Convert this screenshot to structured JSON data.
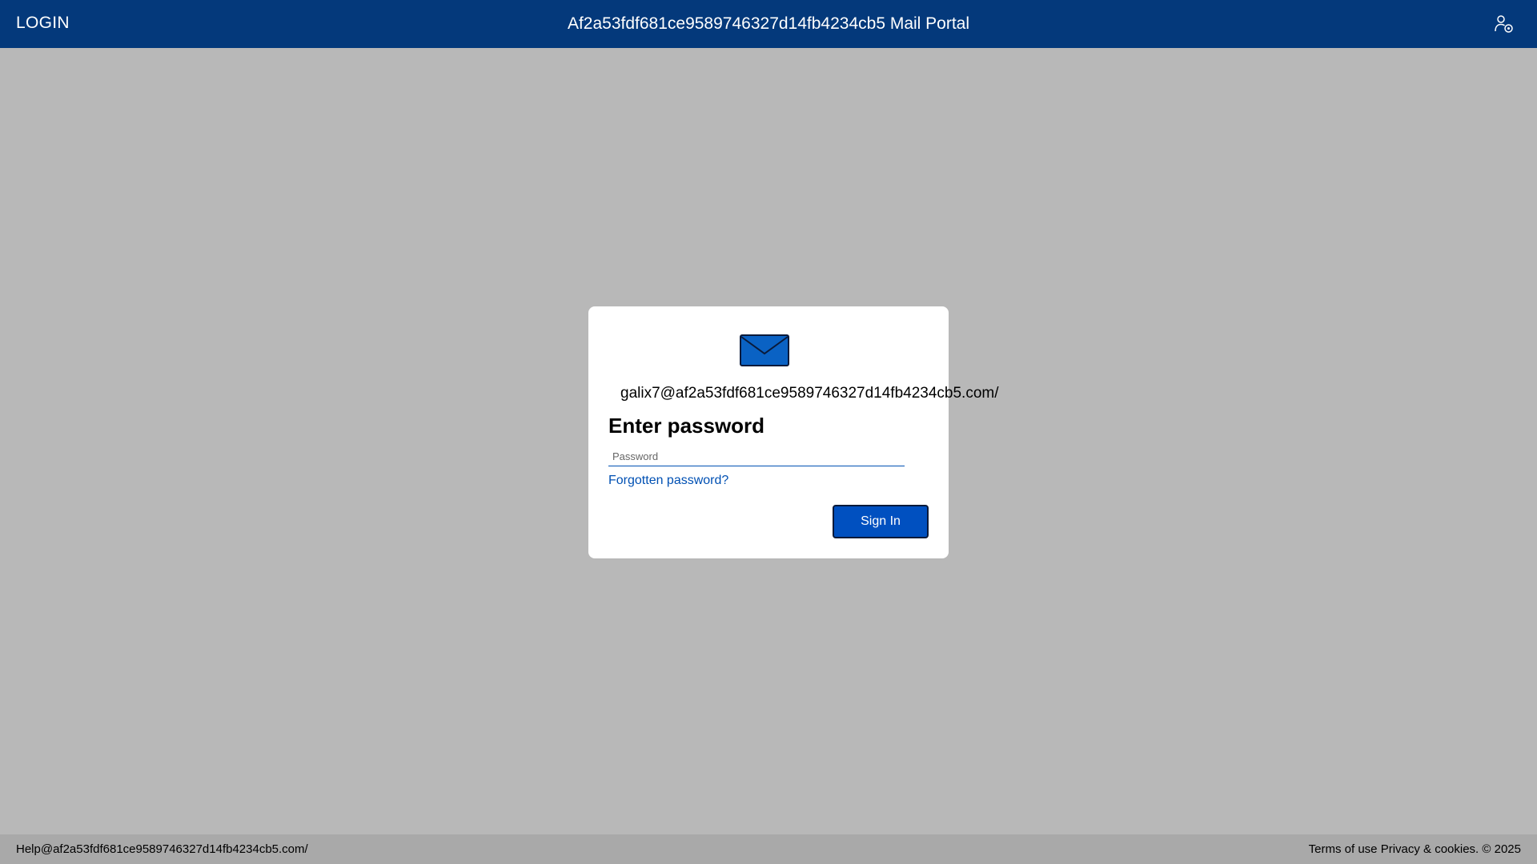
{
  "header": {
    "left_label": "LOGIN",
    "title": "Af2a53fdf681ce9589746327d14fb4234cb5 Mail Portal",
    "account_icon": "user-settings-icon",
    "background_color": "#04397b"
  },
  "login_card": {
    "icon": "envelope-icon",
    "email": "galix7@af2a53fdf681ce9589746327d14fb4234cb5.com/",
    "heading": "Enter password",
    "password_placeholder": "Password",
    "password_value": "",
    "forgot_link": "Forgotten password?",
    "signin_label": "Sign In",
    "accent_color": "#0050c0"
  },
  "footer": {
    "help_text": "Help@af2a53fdf681ce9589746327d14fb4234cb5.com/",
    "terms_label": "Terms of use",
    "privacy_label": "Privacy & cookies.",
    "copyright": "© 2025"
  }
}
